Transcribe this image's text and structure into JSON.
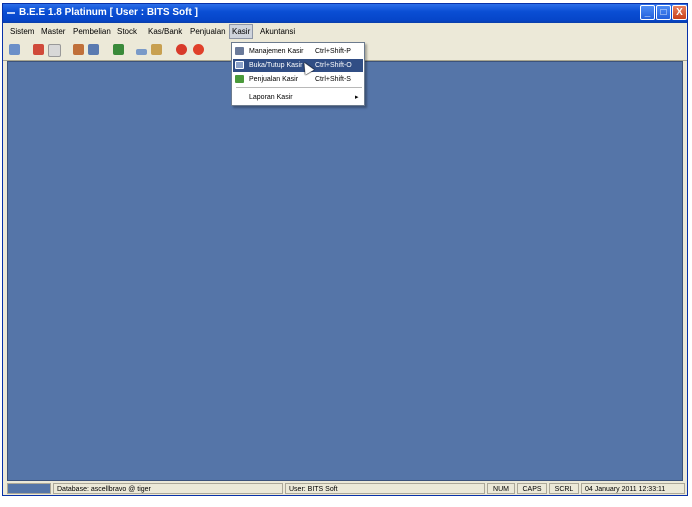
{
  "window": {
    "title": "B.E.E 1.8 Platinum [ User : BITS Soft ]"
  },
  "window_controls": {
    "minimize": "_",
    "maximize": "□",
    "close": "X"
  },
  "menu": {
    "items": [
      {
        "label": "Sistem"
      },
      {
        "label": "Master"
      },
      {
        "label": "Pembelian"
      },
      {
        "label": "Stock"
      },
      {
        "label": "Kas/Bank"
      },
      {
        "label": "Penjualan"
      },
      {
        "label": "Kasir"
      },
      {
        "label": "Akuntansi"
      }
    ]
  },
  "kasir_menu": {
    "items": [
      {
        "label": "Manajemen Kasir",
        "shortcut": "Ctrl+Shift-P",
        "icon": "cash-register-icon"
      },
      {
        "label": "Buka/Tutup Kasir",
        "shortcut": "Ctrl+Shift-O",
        "icon": "open-close-icon"
      },
      {
        "label": "Penjualan Kasir",
        "shortcut": "Ctrl+Shift-S",
        "icon": "sales-icon"
      },
      {
        "label": "Laporan Kasir",
        "submenu_glyph": "▸"
      }
    ]
  },
  "toolbar": {
    "icons": [
      {
        "name": "monitor-icon",
        "color": "#6b8fc8"
      },
      {
        "name": "document-red-icon",
        "color": "#d04a3a"
      },
      {
        "name": "blank-doc-icon",
        "color": "#d8d8d8"
      },
      {
        "name": "people-icon",
        "color": "#c0703a"
      },
      {
        "name": "book-icon",
        "color": "#5a7ab0"
      },
      {
        "name": "upload-icon",
        "color": "#3a8a3a"
      },
      {
        "name": "car-icon",
        "color": "#7a9ac8"
      },
      {
        "name": "box-icon",
        "color": "#c8a050"
      },
      {
        "name": "stop-red-icon",
        "color": "#d83a2a"
      },
      {
        "name": "power-icon",
        "color": "#e0402a"
      }
    ]
  },
  "status": {
    "database": "Database: ascellbravo @ tiger",
    "user": "User: BITS Soft",
    "num": "NUM",
    "caps": "CAPS",
    "scrl": "SCRL",
    "datetime": "04 January 2011  12:33:11"
  },
  "colors": {
    "titlebar": "#0a4ed4",
    "workspace": "#5575a8",
    "menu_highlight": "#314e85"
  }
}
